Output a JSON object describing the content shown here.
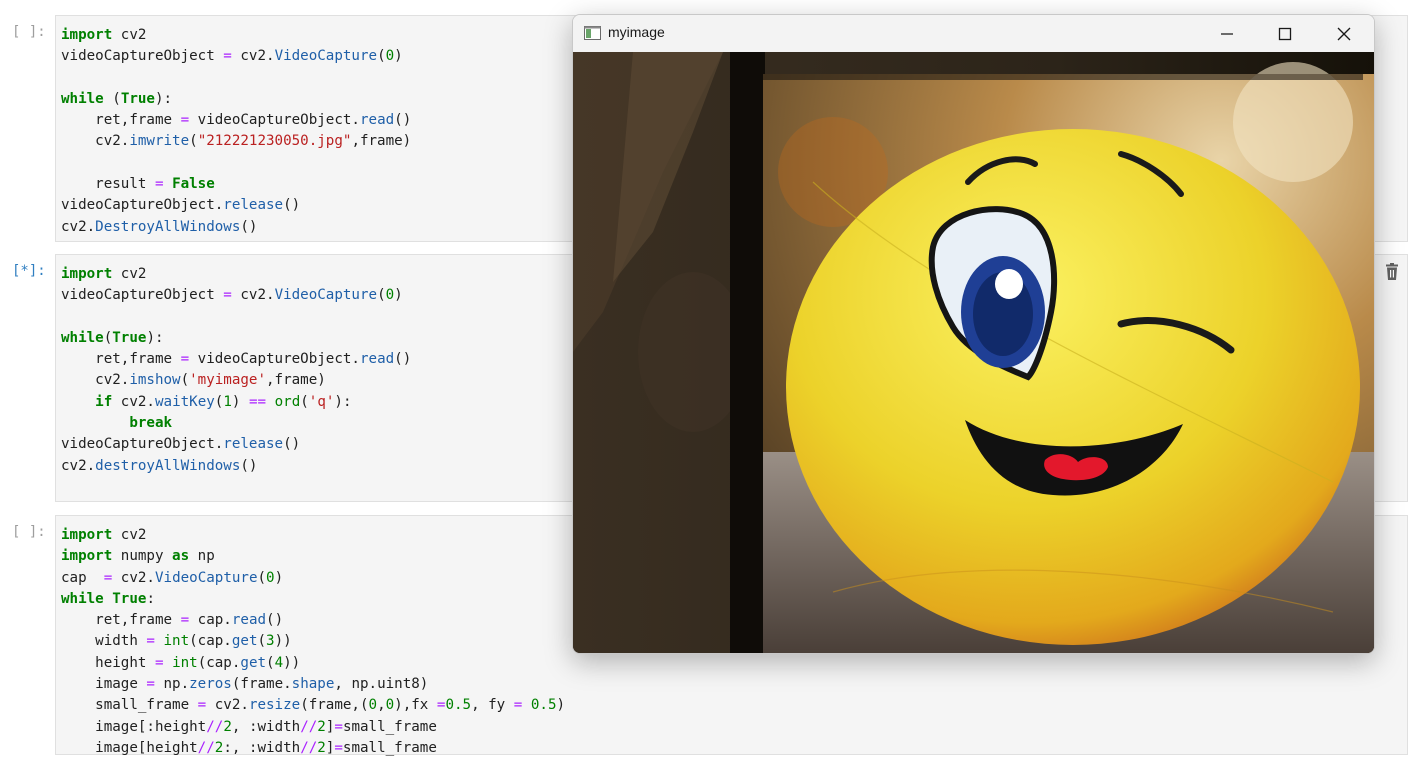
{
  "cells": [
    {
      "prompt": "[ ]:",
      "lines": [
        "import cv2",
        "videoCaptureObject = cv2.VideoCapture(0)",
        "",
        "while (True):",
        "    ret,frame = videoCaptureObject.read()",
        "    cv2.imwrite(\"212221230050.jpg\",frame)",
        "",
        "    result = False",
        "videoCaptureObject.release()",
        "cv2.DestroyAllWindows()"
      ]
    },
    {
      "prompt": "[*]:",
      "lines": [
        "import cv2",
        "videoCaptureObject = cv2.VideoCapture(0)",
        "",
        "while(True):",
        "    ret,frame = videoCaptureObject.read()",
        "    cv2.imshow('myimage',frame)",
        "    if cv2.waitKey(1) == ord('q'):",
        "        break",
        "videoCaptureObject.release()",
        "cv2.destroyAllWindows()"
      ]
    },
    {
      "prompt": "[ ]:",
      "lines": [
        "import cv2",
        "import numpy as np",
        "cap  = cv2.VideoCapture(0)",
        "while True:",
        "    ret,frame = cap.read()",
        "    width = int(cap.get(3))",
        "    height = int(cap.get(4))",
        "    image = np.zeros(frame.shape, np.uint8)",
        "    small_frame = cv2.resize(frame,(0,0),fx =0.5, fy = 0.5)",
        "    image[:height//2, :width//2]=small_frame",
        "    image[height//2:, :width//2]=small_frame"
      ]
    }
  ],
  "window": {
    "title": "myimage",
    "icons": [
      "app-window-icon",
      "minimize-icon",
      "maximize-icon",
      "close-icon"
    ]
  },
  "icons": {
    "delete_cell": "trash-icon"
  },
  "colors": {
    "keyword": "#008000",
    "operator": "#aa22ff",
    "function": "#1f5fa8",
    "string": "#ba2121",
    "prompt_running": "#307fc1"
  }
}
